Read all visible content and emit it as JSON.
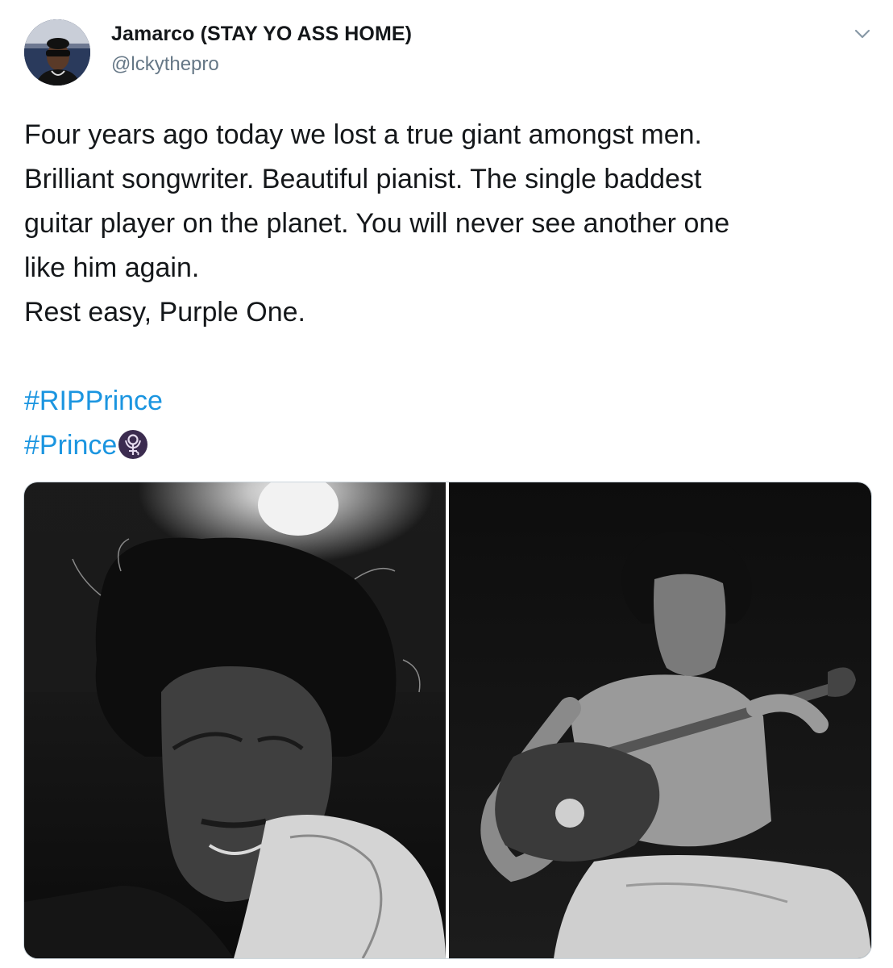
{
  "tweet": {
    "author": {
      "display_name": "Jamarco (STAY YO ASS HOME)",
      "handle": "@lckythepro",
      "avatar_icon": "profile-photo"
    },
    "menu_icon": "chevron-down-icon",
    "text_lines": [
      "Four years ago today we lost a true giant amongst men.",
      "Brilliant songwriter. Beautiful pianist. The single baddest",
      "guitar player on the planet. You will never see another one",
      "like him again.",
      "Rest easy, Purple One."
    ],
    "hashtags": [
      "#RIPPrince",
      "#Prince"
    ],
    "hashtag_emoji": "prince-love-symbol-icon",
    "colors": {
      "hashtag": "#1b95e0",
      "handle": "#657786",
      "emoji_bg": "#3b2b4f"
    },
    "media": {
      "photos": [
        "black-and-white-portrait-photo",
        "black-and-white-guitarist-photo"
      ]
    }
  }
}
